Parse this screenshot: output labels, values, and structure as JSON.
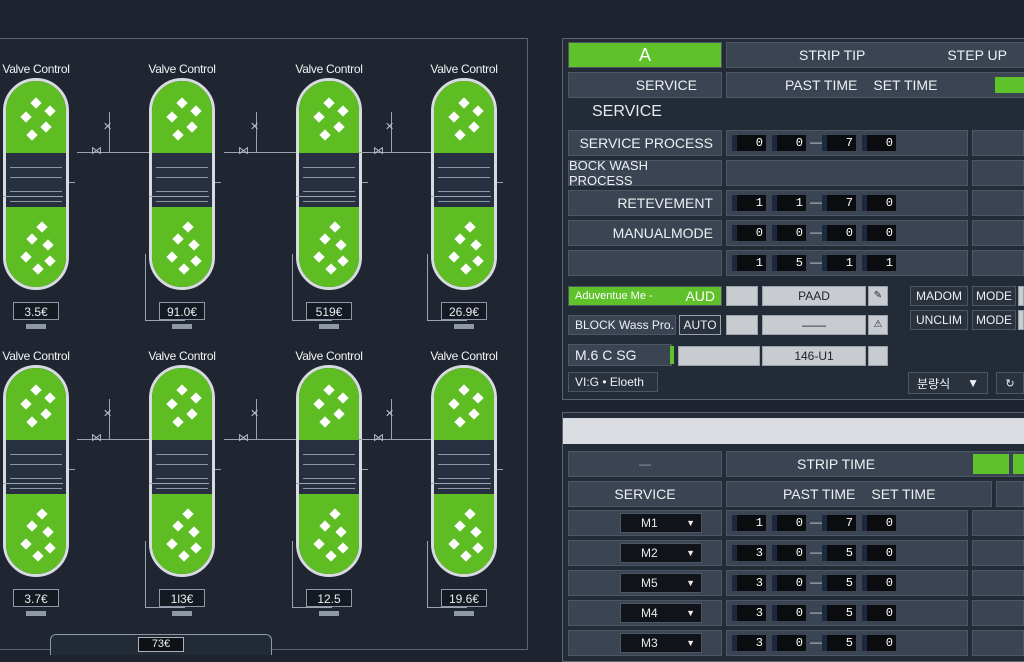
{
  "tanks": [
    {
      "title": "Valve Control",
      "readout": "3.5€"
    },
    {
      "title": "Valve Control",
      "readout": "91.0€"
    },
    {
      "title": "Valve Control",
      "readout": "519€"
    },
    {
      "title": "Valve Control",
      "readout": "26.9€"
    },
    {
      "title": "Valve Control",
      "readout": "3.7€"
    },
    {
      "title": "Valve Control",
      "readout": "1l3€"
    },
    {
      "title": "Valve Control",
      "readout": "12.5"
    },
    {
      "title": "Valve Control",
      "readout": "19.6€"
    }
  ],
  "bottom_readout": "73€",
  "top_panel": {
    "header_a": "A",
    "strip_tip": "STRIP TIP",
    "step_up": "STEP UP",
    "service_tab": "SERVICE",
    "past_time": "PAST TIME",
    "set_time": "SET TIME",
    "section_title": "SERVICE",
    "rows": [
      {
        "label": "SERVICE PROCESS",
        "d": [
          "0",
          "0",
          "7",
          "0"
        ]
      },
      {
        "label": "BOCK WASH PROCESS",
        "d": []
      },
      {
        "label": "RETEVEMENT",
        "d": [
          "1",
          "1",
          "7",
          "0"
        ]
      },
      {
        "label": "MANUALMODE",
        "d": [
          "0",
          "0",
          "0",
          "0"
        ]
      },
      {
        "label": "",
        "d": [
          "1",
          "5",
          "1",
          "1"
        ]
      }
    ],
    "mode_rows": [
      {
        "label": "Aduventue Me -",
        "mode": "AUD",
        "value": "PAAD"
      },
      {
        "label": "BLOCK Wass Pro.",
        "mode": "AUTO",
        "value": "——"
      }
    ],
    "ms_label": "M.6  C    SG",
    "ms_value": "146-U1",
    "footer_label": "VI:G • Eloeth",
    "madom": "MADOM",
    "unclim": "UNCLIM",
    "mode1": "MODE",
    "mode2": "MODE",
    "dropdown": "분량식"
  },
  "bottom_panel": {
    "header_dash": "—",
    "strip_time": "STRIP TIME",
    "service": "SERVICE",
    "past_time": "PAST TIME",
    "set_time": "SET TIME",
    "rows": [
      {
        "sel": "M1",
        "d": [
          "1",
          "0",
          "7",
          "0"
        ]
      },
      {
        "sel": "M2",
        "d": [
          "3",
          "0",
          "5",
          "0"
        ]
      },
      {
        "sel": "M5",
        "d": [
          "3",
          "0",
          "5",
          "0"
        ]
      },
      {
        "sel": "M4",
        "d": [
          "3",
          "0",
          "5",
          "0"
        ]
      },
      {
        "sel": "M3",
        "d": [
          "3",
          "0",
          "5",
          "0"
        ]
      }
    ]
  }
}
